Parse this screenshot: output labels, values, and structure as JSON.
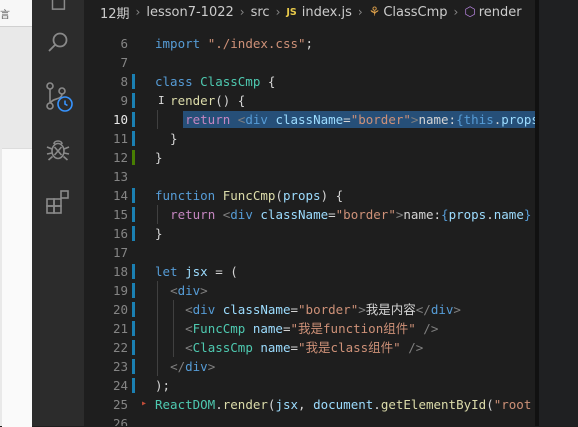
{
  "left_strip": {
    "tab_text": "言"
  },
  "activity_bar": {
    "items": [
      {
        "name": "explorer",
        "icon": "files-icon"
      },
      {
        "name": "search",
        "icon": "search-icon"
      },
      {
        "name": "source-control",
        "icon": "source-control-icon"
      },
      {
        "name": "run-debug",
        "icon": "bug-icon"
      },
      {
        "name": "extensions",
        "icon": "extensions-icon"
      }
    ]
  },
  "breadcrumb": {
    "segments": [
      "12期",
      "lesson7-1022",
      "src",
      "index.js",
      "ClassCmp",
      "render"
    ],
    "file_badge": "JS"
  },
  "editor": {
    "lines": [
      {
        "n": "6",
        "tokens": [
          {
            "c": "k",
            "t": "import "
          },
          {
            "c": "s",
            "t": "\"./index.css\""
          },
          {
            "c": "p",
            "t": ";"
          }
        ]
      },
      {
        "n": "7",
        "tokens": []
      },
      {
        "n": "8",
        "tokens": [
          {
            "c": "k",
            "t": "class "
          },
          {
            "c": "t",
            "t": "ClassCmp"
          },
          {
            "c": "p",
            "t": " {"
          }
        ]
      },
      {
        "n": "9",
        "tokens": [
          {
            "c": "p",
            "t": "  "
          },
          {
            "c": "f",
            "t": "render"
          },
          {
            "c": "p",
            "t": "() {"
          }
        ]
      },
      {
        "n": "10",
        "tokens": [
          {
            "c": "p",
            "t": "    "
          },
          {
            "c": "ctl",
            "t": "return "
          },
          {
            "c": "g",
            "t": "<"
          },
          {
            "c": "k",
            "t": "div "
          },
          {
            "c": "v",
            "t": "className"
          },
          {
            "c": "p",
            "t": "="
          },
          {
            "c": "s",
            "t": "\"border\""
          },
          {
            "c": "g",
            "t": ">"
          },
          {
            "c": "p",
            "t": "name:"
          },
          {
            "c": "k",
            "t": "{"
          },
          {
            "c": "k",
            "t": "this"
          },
          {
            "c": "p",
            "t": "."
          },
          {
            "c": "v",
            "t": "props"
          }
        ]
      },
      {
        "n": "11",
        "tokens": [
          {
            "c": "p",
            "t": "  }"
          }
        ]
      },
      {
        "n": "12",
        "tokens": [
          {
            "c": "p",
            "t": "}"
          }
        ]
      },
      {
        "n": "13",
        "tokens": []
      },
      {
        "n": "14",
        "tokens": [
          {
            "c": "k",
            "t": "function "
          },
          {
            "c": "f",
            "t": "FuncCmp"
          },
          {
            "c": "p",
            "t": "("
          },
          {
            "c": "v",
            "t": "props"
          },
          {
            "c": "p",
            "t": ") {"
          }
        ]
      },
      {
        "n": "15",
        "tokens": [
          {
            "c": "p",
            "t": "  "
          },
          {
            "c": "ctl",
            "t": "return "
          },
          {
            "c": "g",
            "t": "<"
          },
          {
            "c": "k",
            "t": "div "
          },
          {
            "c": "v",
            "t": "className"
          },
          {
            "c": "p",
            "t": "="
          },
          {
            "c": "s",
            "t": "\"border\""
          },
          {
            "c": "g",
            "t": ">"
          },
          {
            "c": "p",
            "t": "name:"
          },
          {
            "c": "k",
            "t": "{"
          },
          {
            "c": "v",
            "t": "props"
          },
          {
            "c": "p",
            "t": "."
          },
          {
            "c": "v",
            "t": "name"
          },
          {
            "c": "k",
            "t": "}"
          }
        ]
      },
      {
        "n": "16",
        "tokens": [
          {
            "c": "p",
            "t": "}"
          }
        ]
      },
      {
        "n": "17",
        "tokens": []
      },
      {
        "n": "18",
        "tokens": [
          {
            "c": "k",
            "t": "let "
          },
          {
            "c": "v",
            "t": "jsx"
          },
          {
            "c": "p",
            "t": " = ("
          }
        ]
      },
      {
        "n": "19",
        "tokens": [
          {
            "c": "p",
            "t": "  "
          },
          {
            "c": "g",
            "t": "<"
          },
          {
            "c": "k",
            "t": "div"
          },
          {
            "c": "g",
            "t": ">"
          }
        ]
      },
      {
        "n": "20",
        "tokens": [
          {
            "c": "p",
            "t": "    "
          },
          {
            "c": "g",
            "t": "<"
          },
          {
            "c": "k",
            "t": "div "
          },
          {
            "c": "v",
            "t": "className"
          },
          {
            "c": "p",
            "t": "="
          },
          {
            "c": "s",
            "t": "\"border\""
          },
          {
            "c": "g",
            "t": ">"
          },
          {
            "c": "p",
            "t": "我是内容"
          },
          {
            "c": "g",
            "t": "</"
          },
          {
            "c": "k",
            "t": "div"
          },
          {
            "c": "g",
            "t": ">"
          }
        ]
      },
      {
        "n": "21",
        "tokens": [
          {
            "c": "p",
            "t": "    "
          },
          {
            "c": "g",
            "t": "<"
          },
          {
            "c": "t",
            "t": "FuncCmp "
          },
          {
            "c": "v",
            "t": "name"
          },
          {
            "c": "p",
            "t": "="
          },
          {
            "c": "s",
            "t": "\"我是function组件\""
          },
          {
            "c": "p",
            "t": " "
          },
          {
            "c": "g",
            "t": "/>"
          }
        ]
      },
      {
        "n": "22",
        "tokens": [
          {
            "c": "p",
            "t": "    "
          },
          {
            "c": "g",
            "t": "<"
          },
          {
            "c": "t",
            "t": "ClassCmp "
          },
          {
            "c": "v",
            "t": "name"
          },
          {
            "c": "p",
            "t": "="
          },
          {
            "c": "s",
            "t": "\"我是class组件\""
          },
          {
            "c": "p",
            "t": " "
          },
          {
            "c": "g",
            "t": "/>"
          }
        ]
      },
      {
        "n": "23",
        "tokens": [
          {
            "c": "p",
            "t": "  "
          },
          {
            "c": "g",
            "t": "</"
          },
          {
            "c": "k",
            "t": "div"
          },
          {
            "c": "g",
            "t": ">"
          }
        ]
      },
      {
        "n": "24",
        "tokens": [
          {
            "c": "p",
            "t": ");"
          }
        ]
      },
      {
        "n": "25",
        "tokens": [
          {
            "c": "t",
            "t": "ReactDOM"
          },
          {
            "c": "p",
            "t": "."
          },
          {
            "c": "f",
            "t": "render"
          },
          {
            "c": "p",
            "t": "("
          },
          {
            "c": "v",
            "t": "jsx"
          },
          {
            "c": "p",
            "t": ", "
          },
          {
            "c": "v",
            "t": "document"
          },
          {
            "c": "p",
            "t": "."
          },
          {
            "c": "f",
            "t": "getElementById"
          },
          {
            "c": "p",
            "t": "("
          },
          {
            "c": "s",
            "t": "\"root"
          }
        ]
      },
      {
        "n": "26",
        "tokens": []
      }
    ],
    "active_line": "10",
    "colors": {
      "keyword": "#569cd6",
      "string": "#ce9178",
      "function": "#dcdcaa",
      "type": "#4ec9b0",
      "variable": "#9cdcfe",
      "selection": "#264f78"
    }
  }
}
